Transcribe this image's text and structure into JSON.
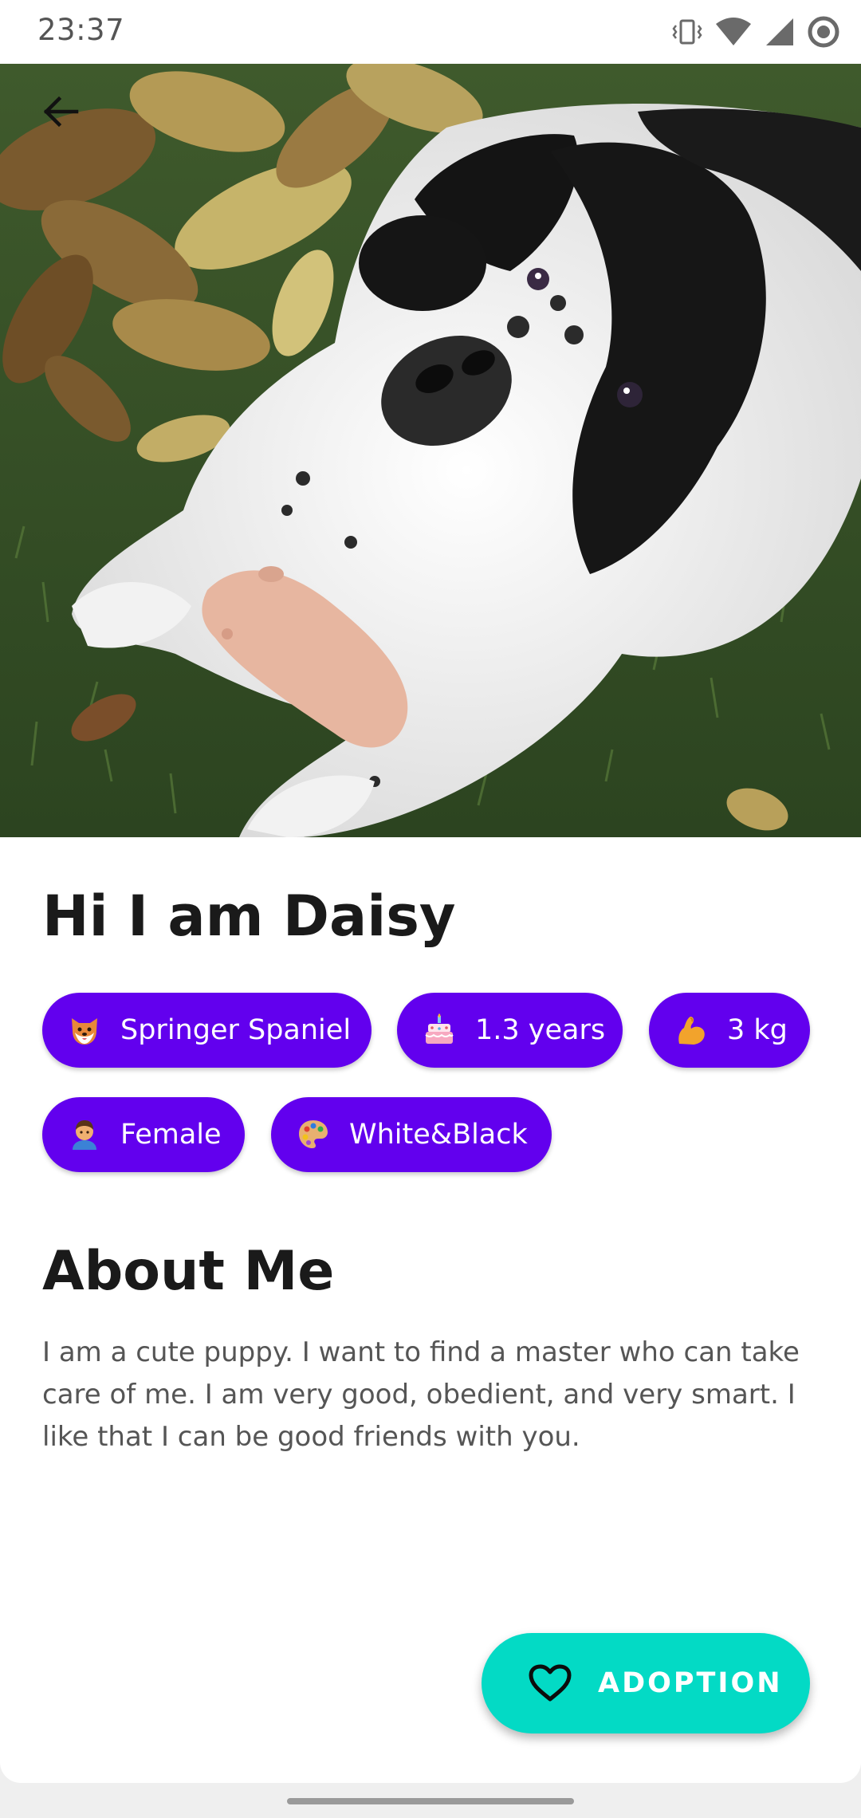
{
  "status_bar": {
    "time": "23:37",
    "icons": [
      "vibrate-icon",
      "wifi-icon",
      "cell-signal-icon",
      "record-icon"
    ]
  },
  "hero": {
    "image": "dog-photo",
    "back_icon": "arrow-back-icon"
  },
  "pet": {
    "title": "Hi I am Daisy",
    "tags": [
      {
        "icon": "dog-face-emoji",
        "label": "Springer Spaniel"
      },
      {
        "icon": "birthday-cake-emoji",
        "label": "1.3 years"
      },
      {
        "icon": "flexed-biceps-emoji",
        "label": "3 kg"
      },
      {
        "icon": "man-emoji",
        "label": "Female"
      },
      {
        "icon": "artist-palette-emoji",
        "label": "White&Black"
      }
    ]
  },
  "about": {
    "title": "About Me",
    "text": "I am a cute puppy. I want to find a master who can take care of me. I am very good, obedient, and very smart. I like that I can be good friends with you."
  },
  "fab": {
    "icon": "heart-outline-icon",
    "label": "ADOPTION"
  },
  "colors": {
    "chip_background": "#6200ee",
    "fab_background": "#03dac5",
    "title_text": "#1a1a1a",
    "body_text": "#555555"
  }
}
